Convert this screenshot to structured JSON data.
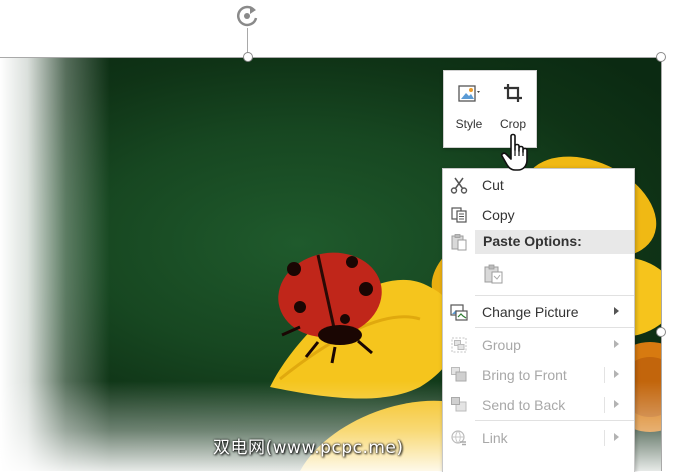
{
  "mini_toolbar": {
    "style_label": "Style",
    "crop_label": "Crop"
  },
  "context_menu": {
    "items": [
      {
        "label": "Cut",
        "icon": "scissors-icon",
        "enabled": true
      },
      {
        "label": "Copy",
        "icon": "copy-icon",
        "enabled": true
      },
      {
        "label": "Paste Options:",
        "icon": "clipboard-icon",
        "enabled": true,
        "header": true
      },
      {
        "label": "Change Picture",
        "icon": "change-picture-icon",
        "enabled": true,
        "submenu": true
      },
      {
        "label": "Group",
        "icon": "group-icon",
        "enabled": false,
        "submenu": true
      },
      {
        "label": "Bring to Front",
        "icon": "bring-to-front-icon",
        "enabled": false,
        "submenu": true
      },
      {
        "label": "Send to Back",
        "icon": "send-to-back-icon",
        "enabled": false,
        "submenu": true
      },
      {
        "label": "Link",
        "icon": "link-icon",
        "enabled": false,
        "submenu": true
      }
    ]
  },
  "watermark": "双电网(www.pcpc.me)",
  "colors": {
    "menu_header_bg": "#e8e8e8",
    "disabled_text": "#a8a8a8",
    "ladybug": "#c0261a",
    "petal": "#f4c21a"
  }
}
